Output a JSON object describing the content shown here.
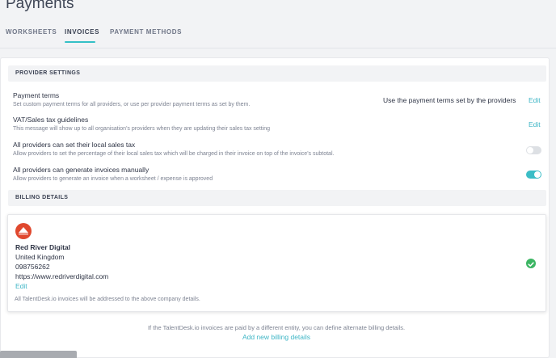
{
  "page": {
    "title": "Payments"
  },
  "tabs": [
    {
      "label": "WORKSHEETS",
      "active": false
    },
    {
      "label": "INVOICES",
      "active": true
    },
    {
      "label": "PAYMENT METHODS",
      "active": false
    }
  ],
  "provider_settings": {
    "header": "PROVIDER SETTINGS",
    "payment_terms": {
      "title": "Payment terms",
      "description": "Set custom payment terms for all providers, or use per provider payment terms as set by them.",
      "value": "Use the payment terms set by the providers",
      "edit_label": "Edit"
    },
    "vat_guidelines": {
      "title": "VAT/Sales tax guidelines",
      "description": "This message will show up to all organisation's providers when they are updating their sales tax setting",
      "edit_label": "Edit"
    },
    "local_sales_tax": {
      "title": "All providers can set their local sales tax",
      "description": "Allow providers to set the percentage of their local sales tax which will be charged in their invoice on top of the invoice's subtotal.",
      "enabled": false
    },
    "generate_invoices": {
      "title": "All providers can generate invoices manually",
      "description": "Allow providers to generate an invoice when a worksheet / expense is approved",
      "enabled": true
    }
  },
  "billing_details": {
    "header": "BILLING DETAILS",
    "company_name": "Red River Digital",
    "country": "United Kingdom",
    "phone": "098756262",
    "website": "https://www.redriverdigital.com",
    "edit_label": "Edit",
    "note": "All TalentDesk.io invoices will be addressed to the above company details.",
    "selected": true
  },
  "footer": {
    "text": "If the TalentDesk.io invoices are paid by a different entity, you can define alternate billing details.",
    "link": "Add new billing details"
  },
  "colors": {
    "accent": "#3fb6c6",
    "toggle_on": "#3bbdc6",
    "check_green": "#3cb563",
    "logo_red": "#e0482e"
  },
  "icons": {
    "company_logo": "red-river-logo-icon",
    "selected": "check-circle-icon"
  }
}
